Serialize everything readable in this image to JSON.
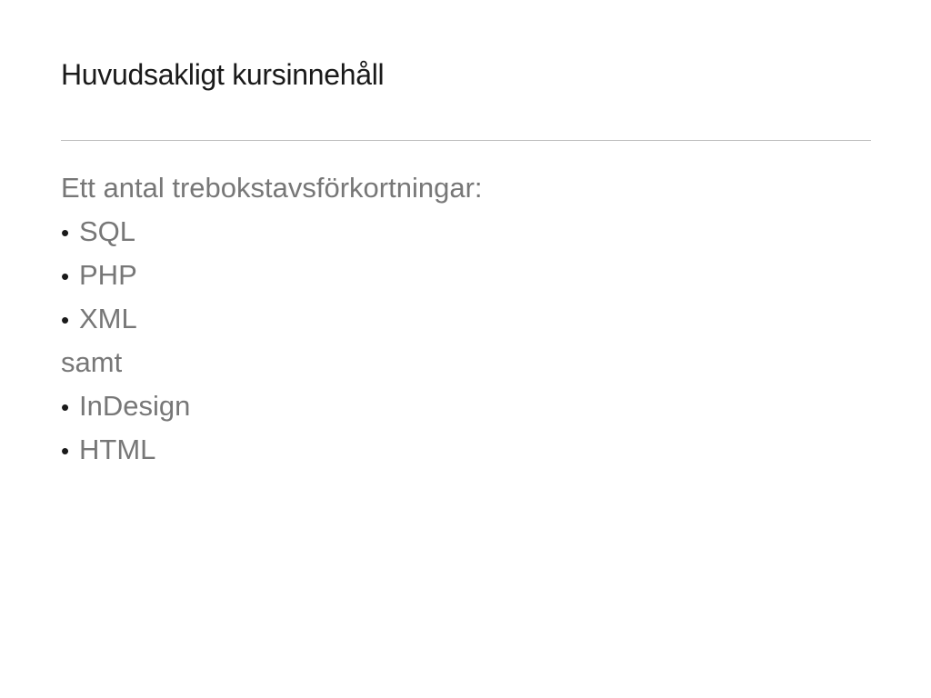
{
  "slide": {
    "title": "Huvudsakligt kursinnehåll",
    "intro": "Ett antal trebokstavsförkortningar:",
    "bullet_symbol": "•",
    "list_a": [
      "SQL",
      "PHP",
      "XML"
    ],
    "connector": "samt",
    "list_b": [
      "InDesign",
      "HTML"
    ]
  }
}
